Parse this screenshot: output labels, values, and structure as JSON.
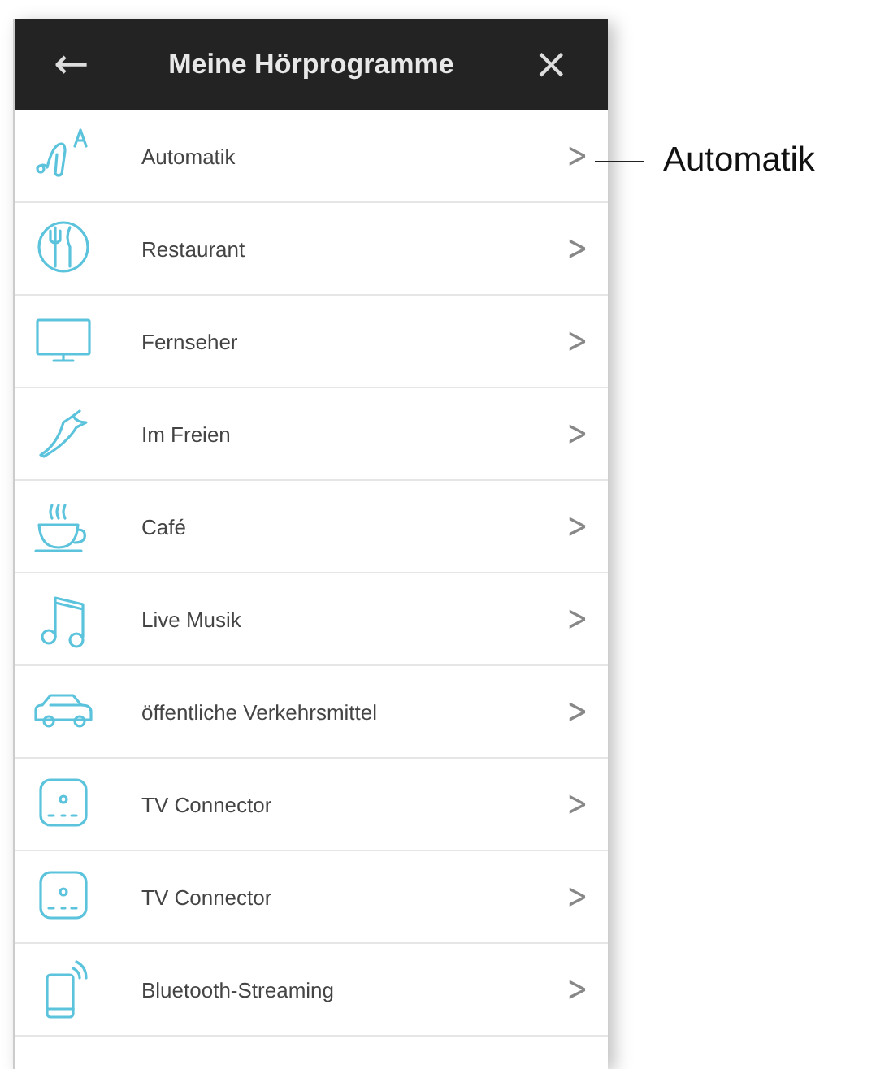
{
  "header": {
    "back": "←",
    "title": "Meine Hörprogramme",
    "close": "×"
  },
  "programs": [
    {
      "label": "Automatik",
      "chevron": ">"
    },
    {
      "label": "Restaurant",
      "chevron": ">"
    },
    {
      "label": "Fernseher",
      "chevron": ">"
    },
    {
      "label": "Im Freien",
      "chevron": ">"
    },
    {
      "label": "Café",
      "chevron": ">"
    },
    {
      "label": "Live Musik",
      "chevron": ">"
    },
    {
      "label": "öffentliche Verkehrsmittel",
      "chevron": ">"
    },
    {
      "label": "TV Connector",
      "chevron": ">"
    },
    {
      "label": "TV Connector",
      "chevron": ">"
    },
    {
      "label": "Bluetooth-Streaming",
      "chevron": ">"
    }
  ],
  "callout": {
    "label": "Automatik"
  }
}
